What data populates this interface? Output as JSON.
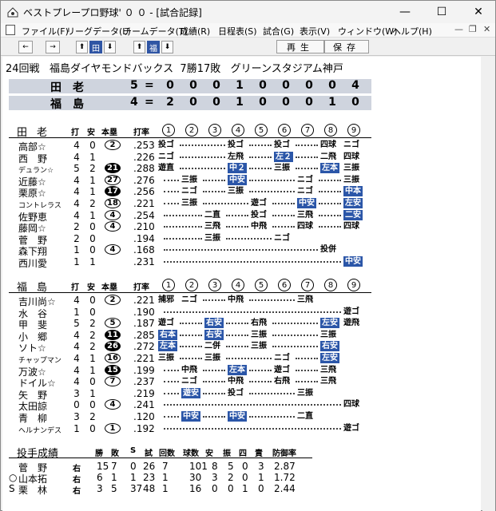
{
  "window": {
    "title": "ベストプレープロ野球' ０ ０ - [試合記録]",
    "minimize": "—",
    "maximize": "☐",
    "close": "✕"
  },
  "menu": [
    "ファイル(F)",
    "リーグデータ(L)",
    "チームデータ(T)",
    "成績(R)",
    "日程表(S)",
    "試合(G)",
    "表示(V)",
    "ウィンドウ(W)",
    "ヘルプ(H)"
  ],
  "mdi": [
    "—",
    "❐",
    "✕"
  ],
  "toolbar": {
    "b1": "←",
    "b2": "→",
    "b3": "⬆",
    "b4": "田",
    "b5": "⬇",
    "b6": "⬆",
    "b7": "福",
    "b8": "⬇",
    "replay": "再生",
    "save": "保存"
  },
  "header": "24回戦   福島ダイヤモンドバックス  7勝17敗   グリーンスタジアム神戸",
  "scoreboard": [
    {
      "team": "田老",
      "runs": "5",
      "eq": "=",
      "innings": [
        "0",
        "0",
        "0",
        "1",
        "0",
        "0",
        "0",
        "0",
        "4"
      ]
    },
    {
      "team": "福島",
      "runs": "4",
      "eq": "=",
      "innings": [
        "2",
        "0",
        "0",
        "1",
        "0",
        "0",
        "0",
        "1",
        "0"
      ]
    }
  ],
  "col_headers": {
    "ab": "打",
    "h": "安",
    "hr": "本塁",
    "avg": "打率",
    "innings": [
      "1",
      "2",
      "3",
      "4",
      "5",
      "6",
      "7",
      "8",
      "9"
    ]
  },
  "away": {
    "label": "田老",
    "players": [
      {
        "name": "高部☆",
        "ab": "4",
        "h": "0",
        "hr": "2",
        "hrfill": false,
        "avg": ".253",
        "res": [
          "投ゴ",
          "",
          "",
          "投ゴ",
          "",
          "投ゴ",
          "",
          "四球",
          "ニゴ"
        ]
      },
      {
        "name": "西　野",
        "ab": "4",
        "h": "1",
        "hr": "",
        "hrfill": false,
        "avg": ".226",
        "res": [
          "ニゴ",
          "",
          "",
          "左飛",
          "",
          "左２",
          "",
          "二飛",
          "四球"
        ]
      },
      {
        "name": "デュラン☆",
        "ab": "5",
        "h": "2",
        "hr": "21",
        "hrfill": true,
        "avg": ".288",
        "res": [
          "遊直",
          "",
          "",
          "中２",
          "",
          "三振",
          "",
          "左本",
          "三振"
        ]
      },
      {
        "name": "近藤☆",
        "ab": "4",
        "h": "1",
        "hr": "27",
        "hrfill": false,
        "avg": ".276",
        "res": [
          "",
          "三振",
          "",
          "中安",
          "",
          "",
          "ニゴ",
          "",
          "三振"
        ]
      },
      {
        "name": "栗原☆",
        "ab": "4",
        "h": "1",
        "hr": "17",
        "hrfill": true,
        "avg": ".256",
        "res": [
          "",
          "ニゴ",
          "",
          "三振",
          "",
          "",
          "ニゴ",
          "",
          "中本"
        ]
      },
      {
        "name": "コントレラス",
        "ab": "4",
        "h": "2",
        "hr": "18",
        "hrfill": false,
        "avg": ".221",
        "res": [
          "",
          "三振",
          "",
          "",
          "遊ゴ",
          "",
          "中安",
          "",
          "左安"
        ]
      },
      {
        "name": "佐野恵",
        "ab": "4",
        "h": "1",
        "hr": "4",
        "hrfill": false,
        "avg": ".254",
        "res": [
          "",
          "",
          "二直",
          "",
          "投ゴ",
          "",
          "三飛",
          "",
          "二安"
        ]
      },
      {
        "name": "藤岡☆",
        "ab": "2",
        "h": "0",
        "hr": "4",
        "hrfill": false,
        "avg": ".210",
        "res": [
          "",
          "",
          "三飛",
          "",
          "中飛",
          "",
          "四球",
          "",
          "四球"
        ]
      },
      {
        "name": "菅　野",
        "ab": "2",
        "h": "0",
        "hr": "",
        "hrfill": false,
        "avg": ".194",
        "res": [
          "",
          "",
          "三振",
          "",
          "",
          "ニゴ",
          "",
          "",
          ""
        ]
      },
      {
        "name": "森下翔",
        "ab": "1",
        "h": "0",
        "hr": "4",
        "hrfill": false,
        "avg": ".168",
        "res": [
          "",
          "",
          "",
          "",
          "",
          "",
          "",
          "投併",
          ""
        ]
      },
      {
        "name": "西川愛",
        "ab": "1",
        "h": "1",
        "hr": "",
        "hrfill": false,
        "avg": ".231",
        "res": [
          "",
          "",
          "",
          "",
          "",
          "",
          "",
          "",
          "中安"
        ]
      }
    ]
  },
  "home": {
    "label": "福島",
    "players": [
      {
        "name": "吉川尚☆",
        "ab": "4",
        "h": "0",
        "hr": "2",
        "hrfill": false,
        "avg": ".221",
        "res": [
          "捕邪",
          "ニゴ",
          "",
          "中飛",
          "",
          "",
          "三飛",
          "",
          ""
        ]
      },
      {
        "name": "水　谷",
        "ab": "1",
        "h": "0",
        "hr": "",
        "hrfill": false,
        "avg": ".190",
        "res": [
          "",
          "",
          "",
          "",
          "",
          "",
          "",
          "",
          "遊ゴ"
        ]
      },
      {
        "name": "甲　斐",
        "ab": "5",
        "h": "2",
        "hr": "5",
        "hrfill": false,
        "avg": ".187",
        "res": [
          "遊ゴ",
          "",
          "右安",
          "",
          "右飛",
          "",
          "",
          "左安",
          "遊飛"
        ]
      },
      {
        "name": "小　郷",
        "ab": "4",
        "h": "2",
        "hr": "11",
        "hrfill": true,
        "avg": ".285",
        "res": [
          "右本",
          "",
          "右安",
          "",
          "三振",
          "",
          "",
          "三振",
          ""
        ]
      },
      {
        "name": "ソト☆",
        "ab": "4",
        "h": "2",
        "hr": "26",
        "hrfill": true,
        "avg": ".272",
        "res": [
          "左本",
          "",
          "二併",
          "",
          "三振",
          "",
          "",
          "右安",
          ""
        ]
      },
      {
        "name": "チャップマン",
        "ab": "4",
        "h": "1",
        "hr": "16",
        "hrfill": false,
        "avg": ".221",
        "res": [
          "三振",
          "",
          "三振",
          "",
          "",
          "ニゴ",
          "",
          "左安",
          ""
        ]
      },
      {
        "name": "万波☆",
        "ab": "4",
        "h": "1",
        "hr": "15",
        "hrfill": true,
        "avg": ".199",
        "res": [
          "",
          "中飛",
          "",
          "左本",
          "",
          "遊ゴ",
          "",
          "三飛",
          ""
        ]
      },
      {
        "name": "ドイル☆",
        "ab": "4",
        "h": "0",
        "hr": "7",
        "hrfill": false,
        "avg": ".237",
        "res": [
          "",
          "ニゴ",
          "",
          "中飛",
          "",
          "右飛",
          "",
          "三飛",
          ""
        ]
      },
      {
        "name": "矢　野",
        "ab": "3",
        "h": "1",
        "hr": "",
        "hrfill": false,
        "avg": ".219",
        "res": [
          "",
          "遊安",
          "",
          "投ゴ",
          "",
          "",
          "三振",
          "",
          ""
        ]
      },
      {
        "name": "太田諒",
        "ab": "0",
        "h": "0",
        "hr": "4",
        "hrfill": false,
        "avg": ".241",
        "res": [
          "",
          "",
          "",
          "",
          "",
          "",
          "",
          "",
          "四球"
        ]
      },
      {
        "name": "青　柳",
        "ab": "3",
        "h": "2",
        "hr": "",
        "hrfill": false,
        "avg": ".120",
        "res": [
          "",
          "中安",
          "",
          "中安",
          "",
          "",
          "二直",
          "",
          ""
        ]
      },
      {
        "name": "ヘルナンデス",
        "ab": "1",
        "h": "0",
        "hr": "1",
        "hrfill": false,
        "avg": ".192",
        "res": [
          "",
          "",
          "",
          "",
          "",
          "",
          "",
          "",
          "遊ゴ"
        ]
      }
    ]
  },
  "pitching": {
    "title": "投手成績",
    "headers": [
      "勝",
      "敗",
      "S",
      "試",
      "回数",
      "球数",
      "安",
      "振",
      "四",
      "責",
      "防御率"
    ],
    "rows": [
      {
        "mark": "",
        "name": "菅　野",
        "hand": "右",
        "vals": [
          "15",
          "7",
          "0",
          "26",
          "7",
          "101",
          "8",
          "5",
          "0",
          "3",
          "2.87"
        ]
      },
      {
        "mark": "○",
        "name": "山本拓",
        "hand": "右",
        "vals": [
          "6",
          "1",
          "1",
          "23",
          "1",
          "30",
          "3",
          "2",
          "0",
          "1",
          "1.72"
        ]
      },
      {
        "mark": "S",
        "name": "栗　林",
        "hand": "右",
        "vals": [
          "3",
          "5",
          "37",
          "48",
          "1",
          "16",
          "0",
          "0",
          "1",
          "0",
          "2.44"
        ]
      }
    ]
  }
}
